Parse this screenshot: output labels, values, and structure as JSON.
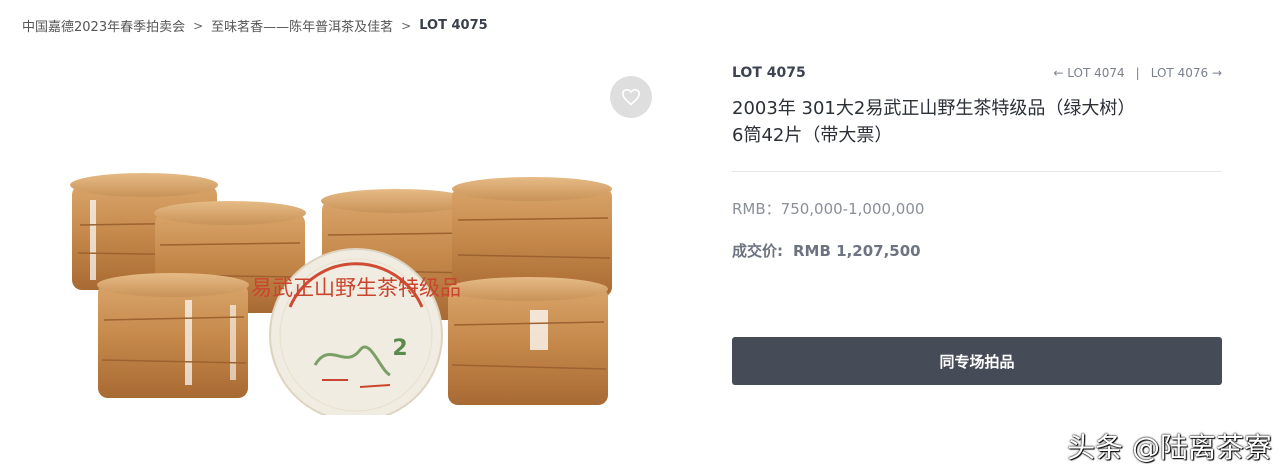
{
  "breadcrumb": {
    "items": [
      "中国嘉德2023年春季拍卖会",
      "至味茗香——陈年普洱茶及佳茗"
    ],
    "current": "LOT 4075",
    "separator": ">"
  },
  "lot": {
    "number": "LOT 4075",
    "prev_label": "LOT 4074",
    "next_label": "LOT 4076",
    "nav_separator": "|",
    "title_line1": "2003年 301大2易武正山野生茶特级品（绿大树）",
    "title_line2": "6筒42片（带大票）"
  },
  "estimate": {
    "text": "RMB：750,000-1,000,000"
  },
  "sold": {
    "label": "成交价:",
    "amount": "RMB 1,207,500"
  },
  "actions": {
    "same_session_button": "同专场拍品"
  },
  "image": {
    "cake_text": "易武正山野生茶特级品",
    "cake_number": "2"
  },
  "watermark": "头条 @陆离茶寮",
  "colors": {
    "button_bg": "#464c57",
    "wrapper_brown": "#c78a4f",
    "cake_red": "#d2503a",
    "cake_green": "#6b8f5a"
  },
  "icons": [
    "heart-icon",
    "arrow-left-icon",
    "arrow-right-icon"
  ]
}
